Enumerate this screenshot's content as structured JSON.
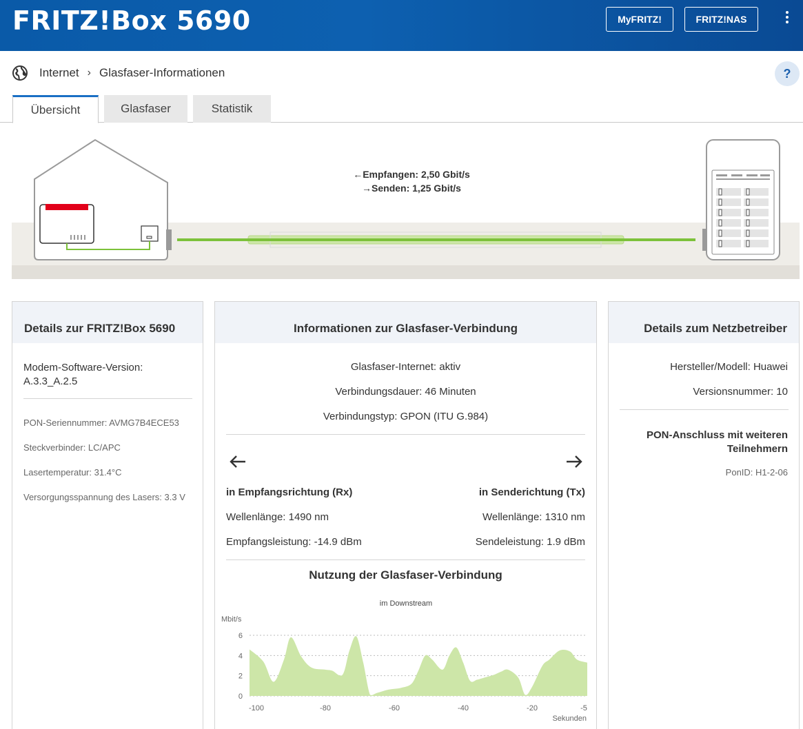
{
  "header": {
    "title": "FRITZ!Box 5690",
    "myfritz_label": "MyFRITZ!",
    "nas_label": "FRITZ!NAS"
  },
  "breadcrumb": {
    "level1": "Internet",
    "level2": "Glasfaser-Informationen",
    "help": "?"
  },
  "tabs": [
    {
      "label": "Übersicht",
      "active": true
    },
    {
      "label": "Glasfaser",
      "active": false
    },
    {
      "label": "Statistik",
      "active": false
    }
  ],
  "illustration": {
    "receive": "Empfangen: 2,50 Gbit/s",
    "send": "Senden: 1,25 Gbit/s",
    "receive_arrow": "←",
    "send_arrow": "→"
  },
  "card_box": {
    "title": "Details zur FRITZ!Box 5690",
    "firmware_label": "Modem-Software-Version:",
    "firmware_value": "A.3.3_A.2.5",
    "pon_serial": "PON-Seriennummer: AVMG7B4ECE53",
    "connector": "Steckverbinder: LC/APC",
    "laser_temp": "Lasertemperatur: 31.4°C",
    "laser_voltage": "Versorgungsspannung des Lasers: 3.3 V"
  },
  "card_fiber": {
    "title": "Informationen zur Glasfaser-Verbindung",
    "status": "Glasfaser-Internet: aktiv",
    "duration": "Verbindungsdauer: 46 Minuten",
    "type": "Verbindungstyp: GPON (ITU G.984)",
    "rx_title": "in Empfangsrichtung (Rx)",
    "rx_wavelength": "Wellenlänge: 1490 nm",
    "rx_power": "Empfangsleistung: -14.9 dBm",
    "tx_title": "in Senderichtung (Tx)",
    "tx_wavelength": "Wellenlänge: 1310 nm",
    "tx_power": "Sendeleistung: 1.9 dBm",
    "usage_title": "Nutzung der Glasfaser-Verbindung"
  },
  "card_operator": {
    "title": "Details zum Netzbetreiber",
    "manufacturer": "Hersteller/Modell: Huawei",
    "version": "Versionsnummer: 10",
    "pon_title_line1": "PON-Anschluss mit weiteren",
    "pon_title_line2": "Teilnehmern",
    "pon_id": "PonID: H1-2-06"
  },
  "colors": {
    "header_blue": "#0a5aa8",
    "fiber_green": "#7cc13a",
    "chart_fill": "#cde6a8",
    "fritz_red": "#e2001a"
  },
  "chart_data": {
    "type": "area",
    "title": "im Downstream",
    "ylabel": "Mbit/s",
    "xlabel": "Sekunden",
    "ylim": [
      0,
      6
    ],
    "yticks": [
      0,
      2,
      4,
      6
    ],
    "xticks": [
      -100,
      -80,
      -60,
      -40,
      -20,
      -5
    ],
    "x": [
      -102,
      -98,
      -95,
      -92,
      -90,
      -87,
      -84,
      -80,
      -78,
      -75,
      -73,
      -71,
      -69,
      -67,
      -65,
      -62,
      -60,
      -58,
      -55,
      -53,
      -51,
      -49,
      -46,
      -44,
      -42,
      -40,
      -38,
      -36,
      -34,
      -31,
      -29,
      -27,
      -24,
      -22,
      -20,
      -17,
      -15,
      -12,
      -9,
      -7,
      -4
    ],
    "series": [
      {
        "values": [
          4.6,
          3.4,
          1.4,
          3.6,
          5.8,
          3.9,
          2.8,
          2.6,
          2.5,
          2.1,
          4.5,
          5.9,
          3.3,
          0.1,
          0.3,
          0.6,
          0.7,
          0.8,
          1.2,
          2.5,
          4.0,
          3.6,
          2.6,
          4.0,
          4.8,
          3.3,
          1.5,
          1.6,
          1.8,
          2.1,
          2.4,
          2.6,
          1.8,
          0.1,
          0.9,
          3.0,
          3.6,
          4.5,
          4.4,
          3.6,
          3.3
        ]
      }
    ]
  }
}
